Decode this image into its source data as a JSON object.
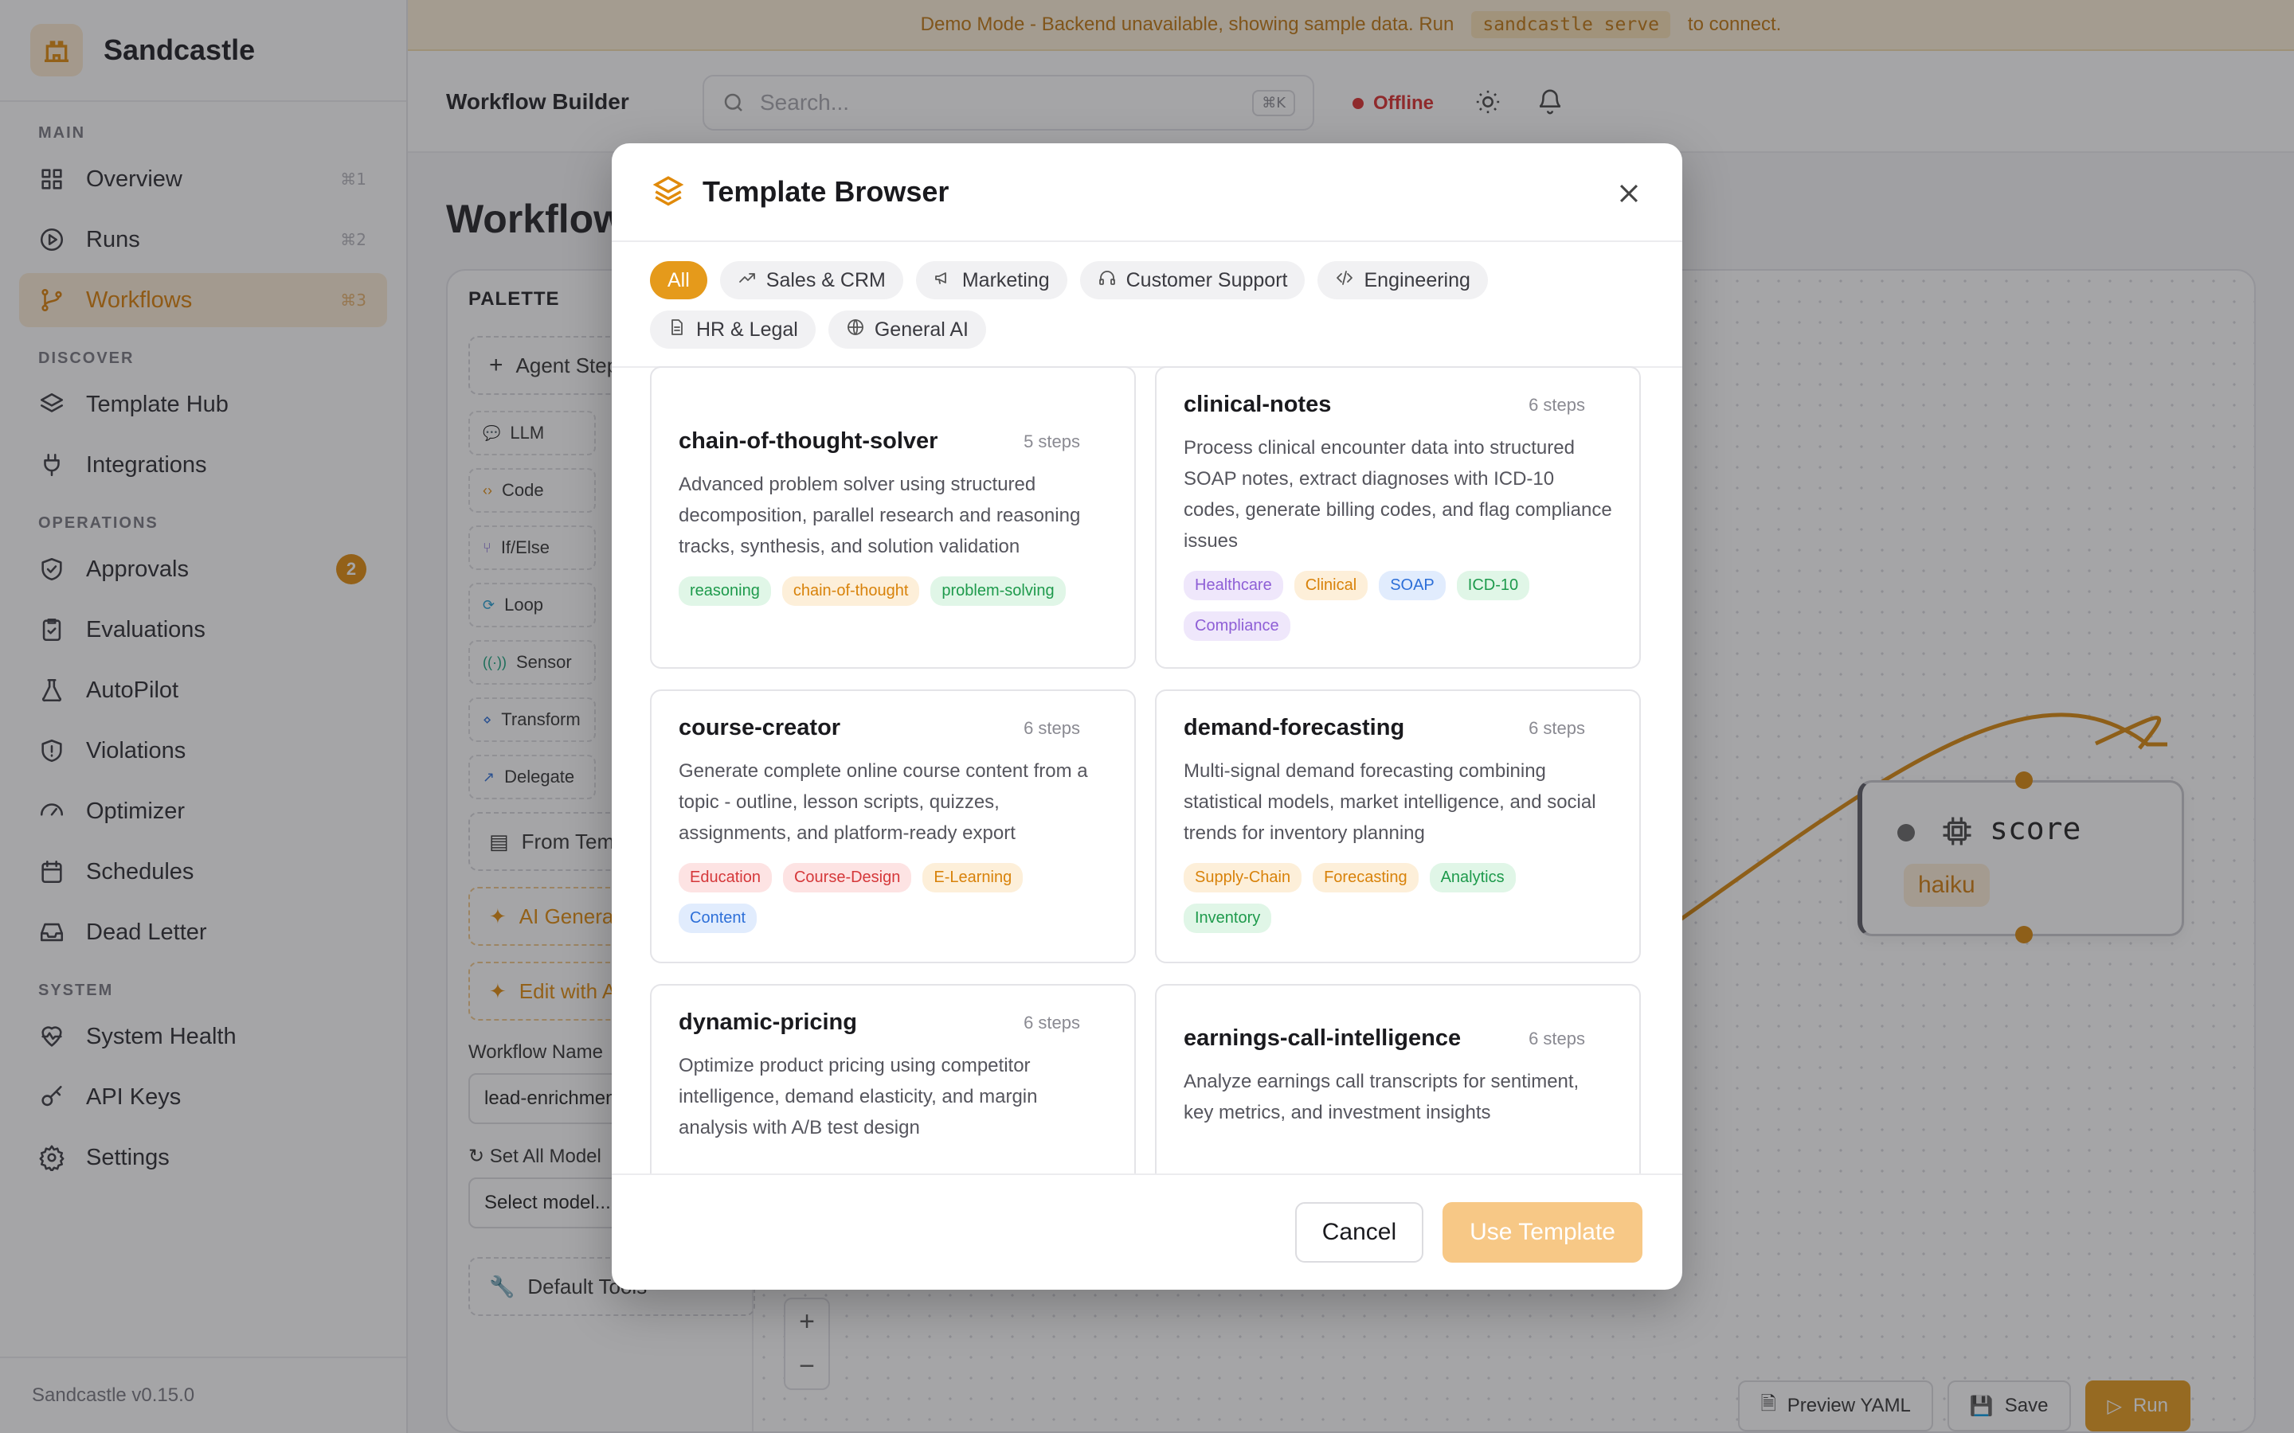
{
  "app": {
    "name": "Sandcastle",
    "version": "Sandcastle v0.15.0"
  },
  "banner": {
    "text_before": "Demo Mode - Backend unavailable, showing sample data. Run",
    "command": "sandcastle serve",
    "text_after": "to connect."
  },
  "sidebar": {
    "sections": [
      {
        "title": "MAIN",
        "items": [
          {
            "label": "Overview",
            "shortcut": "⌘1",
            "icon": "grid-icon"
          },
          {
            "label": "Runs",
            "shortcut": "⌘2",
            "icon": "play-circle-icon"
          },
          {
            "label": "Workflows",
            "shortcut": "⌘3",
            "icon": "git-branch-icon",
            "active": true
          }
        ]
      },
      {
        "title": "DISCOVER",
        "items": [
          {
            "label": "Template Hub",
            "icon": "layers-icon"
          },
          {
            "label": "Integrations",
            "icon": "plug-icon"
          }
        ]
      },
      {
        "title": "OPERATIONS",
        "items": [
          {
            "label": "Approvals",
            "icon": "shield-check-icon",
            "badge": "2"
          },
          {
            "label": "Evaluations",
            "icon": "clipboard-check-icon"
          },
          {
            "label": "AutoPilot",
            "icon": "flask-icon"
          },
          {
            "label": "Violations",
            "icon": "shield-alert-icon"
          },
          {
            "label": "Optimizer",
            "icon": "gauge-icon"
          },
          {
            "label": "Schedules",
            "icon": "calendar-icon"
          },
          {
            "label": "Dead Letter",
            "icon": "inbox-icon"
          }
        ]
      },
      {
        "title": "SYSTEM",
        "items": [
          {
            "label": "System Health",
            "icon": "heart-pulse-icon"
          },
          {
            "label": "API Keys",
            "icon": "key-icon"
          },
          {
            "label": "Settings",
            "icon": "gear-icon"
          }
        ]
      }
    ]
  },
  "topbar": {
    "title": "Workflow Builder",
    "search_placeholder": "Search...",
    "search_shortcut": "⌘K",
    "status": "Offline"
  },
  "page": {
    "heading": "Workflow"
  },
  "palette": {
    "title": "PALETTE",
    "agent_step": "Agent Step",
    "chips": [
      "LLM",
      "Code",
      "If/Else",
      "Loop",
      "Sensor",
      "Transform",
      "Delegate"
    ],
    "from_template": "From Temp",
    "ai_generate": "AI Genera",
    "edit_with_ai": "Edit with A",
    "workflow_name_label": "Workflow Name",
    "workflow_name_value": "lead-enrichmen",
    "set_all_models_label": "Set All Model",
    "select_model": "Select model...",
    "default_tools": "Default Tools"
  },
  "node": {
    "title": "score",
    "model": "haiku"
  },
  "canvas_actions": {
    "preview": "Preview YAML",
    "save": "Save",
    "run": "Run"
  },
  "modal": {
    "title": "Template Browser",
    "filters": [
      {
        "label": "All",
        "active": true,
        "icon": ""
      },
      {
        "label": "Sales & CRM",
        "icon": "trending-up-icon"
      },
      {
        "label": "Marketing",
        "icon": "megaphone-icon"
      },
      {
        "label": "Customer Support",
        "icon": "headphones-icon"
      },
      {
        "label": "Engineering",
        "icon": "code-icon"
      },
      {
        "label": "HR & Legal",
        "icon": "document-icon"
      },
      {
        "label": "General AI",
        "icon": "globe-icon"
      }
    ],
    "templates": [
      {
        "name": "chain-of-thought-solver",
        "steps": "5 steps",
        "desc": "Advanced problem solver using structured decomposition, parallel research and reasoning tracks, synthesis, and solution validation",
        "tags": [
          [
            "reasoning",
            "green"
          ],
          [
            "chain-of-thought",
            "orange"
          ],
          [
            "problem-solving",
            "green"
          ]
        ]
      },
      {
        "name": "clinical-notes",
        "steps": "6 steps",
        "desc": "Process clinical encounter data into structured SOAP notes, extract diagnoses with ICD-10 codes, generate billing codes, and flag compliance issues",
        "tags": [
          [
            "Healthcare",
            "purple"
          ],
          [
            "Clinical",
            "orange"
          ],
          [
            "SOAP",
            "blue"
          ],
          [
            "ICD-10",
            "green"
          ],
          [
            "Compliance",
            "purple"
          ]
        ]
      },
      {
        "name": "course-creator",
        "steps": "6 steps",
        "desc": "Generate complete online course content from a topic - outline, lesson scripts, quizzes, assignments, and platform-ready export",
        "tags": [
          [
            "Education",
            "red"
          ],
          [
            "Course-Design",
            "red"
          ],
          [
            "E-Learning",
            "orange"
          ],
          [
            "Content",
            "blue"
          ]
        ]
      },
      {
        "name": "demand-forecasting",
        "steps": "6 steps",
        "desc": "Multi-signal demand forecasting combining statistical models, market intelligence, and social trends for inventory planning",
        "tags": [
          [
            "Supply-Chain",
            "orange"
          ],
          [
            "Forecasting",
            "orange"
          ],
          [
            "Analytics",
            "green"
          ],
          [
            "Inventory",
            "green"
          ]
        ]
      },
      {
        "name": "dynamic-pricing",
        "steps": "6 steps",
        "desc": "Optimize product pricing using competitor intelligence, demand elasticity, and margin analysis with A/B test design",
        "tags": []
      },
      {
        "name": "earnings-call-intelligence",
        "steps": "6 steps",
        "desc": "Analyze earnings call transcripts for sentiment, key metrics, and investment insights",
        "tags": []
      }
    ],
    "cancel": "Cancel",
    "use_template": "Use Template"
  }
}
